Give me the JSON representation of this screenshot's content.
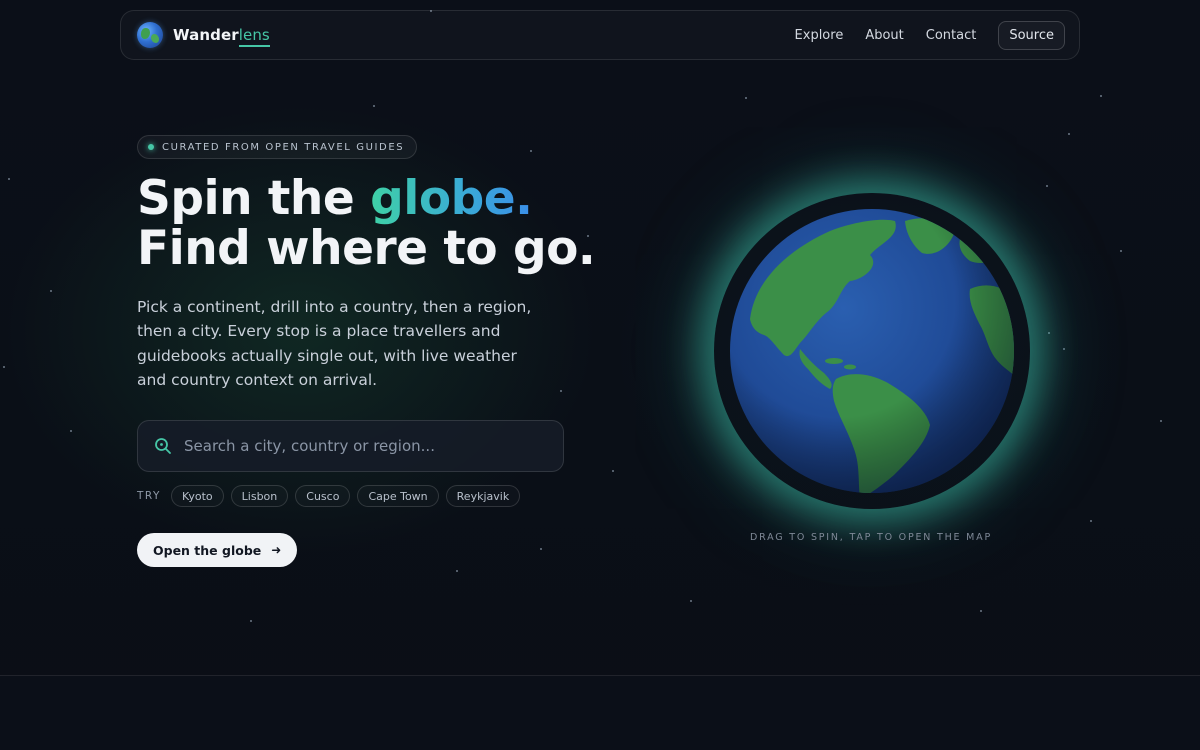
{
  "brand": {
    "name_main": "Wander",
    "name_accent": "lens"
  },
  "nav": {
    "links": [
      "Explore",
      "About",
      "Contact"
    ],
    "source_label": "Source"
  },
  "hero": {
    "badge": "CURATED FROM OPEN TRAVEL GUIDES",
    "headline": {
      "line1_plain": "Spin the ",
      "line1_accent": "globe.",
      "line2": "Find where to go."
    },
    "lead": "Pick a continent, drill into a country, then a region, then a city. Every stop is a place travellers and guidebooks actually single out, with live weather and country context on arrival.",
    "search": {
      "placeholder": "Search a city, country or region...",
      "value": ""
    },
    "try_label": "TRY",
    "suggestions": [
      "Kyoto",
      "Lisbon",
      "Cusco",
      "Cape Town",
      "Reykjavik"
    ],
    "cta_label": "Open the globe",
    "cta_icon": "arrow-right-icon"
  },
  "globe": {
    "caption": "DRAG TO SPIN, TAP TO OPEN THE MAP"
  },
  "colors": {
    "background": "#0a0e16",
    "accent": "#46c6a6",
    "ocean": "#1f4d9a",
    "land": "#3b8f48",
    "glow": "#46dcbe"
  }
}
